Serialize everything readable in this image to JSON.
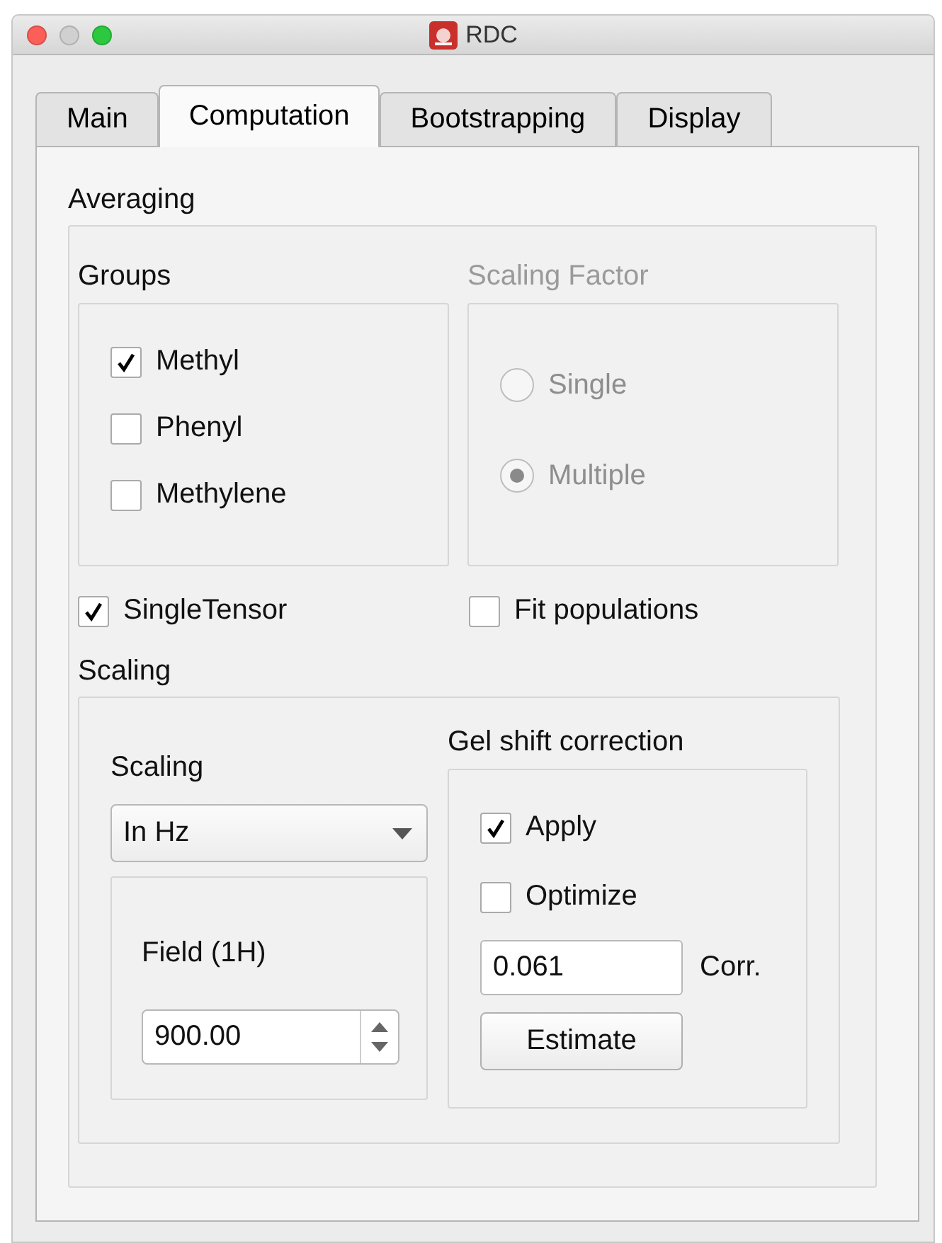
{
  "window": {
    "title": "RDC"
  },
  "tabs": [
    {
      "label": "Main",
      "selected": false
    },
    {
      "label": "Computation",
      "selected": true
    },
    {
      "label": "Bootstrapping",
      "selected": false
    },
    {
      "label": "Display",
      "selected": false
    }
  ],
  "averaging": {
    "title": "Averaging",
    "groups": {
      "title": "Groups",
      "items": [
        {
          "label": "Methyl",
          "checked": true
        },
        {
          "label": "Phenyl",
          "checked": false
        },
        {
          "label": "Methylene",
          "checked": false
        }
      ]
    },
    "scaling_factor": {
      "title": "Scaling Factor",
      "disabled": true,
      "options": [
        {
          "label": "Single",
          "selected": false
        },
        {
          "label": "Multiple",
          "selected": true
        }
      ]
    },
    "single_tensor": {
      "label": "SingleTensor",
      "checked": true
    },
    "fit_populations": {
      "label": "Fit populations",
      "checked": false
    },
    "scaling": {
      "title": "Scaling",
      "inner_title": "Scaling",
      "dropdown": {
        "value": "In Hz"
      },
      "field": {
        "label": "Field (1H)",
        "value": "900.00"
      },
      "gel_shift": {
        "title": "Gel shift correction",
        "apply": {
          "label": "Apply",
          "checked": true
        },
        "optimize": {
          "label": "Optimize",
          "checked": false
        },
        "corr": {
          "value": "0.061",
          "label": "Corr."
        },
        "button": "Estimate"
      }
    }
  }
}
